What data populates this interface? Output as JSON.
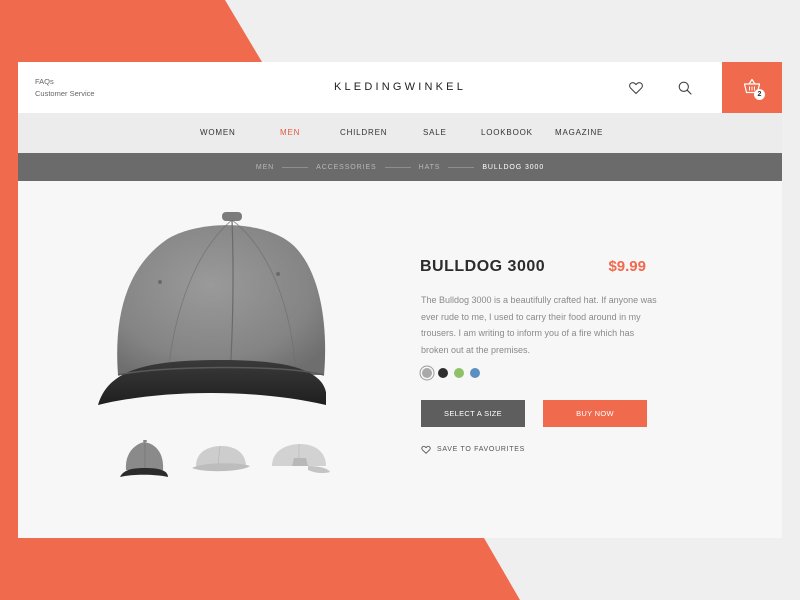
{
  "colors": {
    "accent": "#f06a4e",
    "breadcrumb_bg": "#6b6b6b",
    "nav_bg": "#ececec",
    "dark_button": "#5e5e5e"
  },
  "header": {
    "help_links": [
      "FAQs",
      "Customer Service"
    ],
    "logo": "KLEDINGWINKEL",
    "favourites_icon": "heart-icon",
    "search_icon": "search-icon",
    "cart_icon": "basket-icon",
    "cart_count": "2"
  },
  "nav": {
    "items": [
      {
        "label": "WOMEN",
        "active": false
      },
      {
        "label": "MEN",
        "active": true
      },
      {
        "label": "CHILDREN",
        "active": false
      },
      {
        "label": "SALE",
        "active": false
      },
      {
        "label": "LOOKBOOK",
        "active": false
      },
      {
        "label": "MAGAZINE",
        "active": false
      }
    ]
  },
  "breadcrumb": [
    "MEN",
    "ACCESSORIES",
    "HATS",
    "BULLDOG 3000"
  ],
  "product": {
    "name": "BULLDOG 3000",
    "price": "$9.99",
    "description": "The Bulldog 3000 is a beautifully crafted hat. If anyone was ever rude to me, I used to carry their food around in my trousers. I am writing to inform you of a fire which has broken out at the premises.",
    "colors": [
      {
        "name": "grey",
        "hex": "#a9a9a9",
        "selected": true
      },
      {
        "name": "black",
        "hex": "#2e2e2e",
        "selected": false
      },
      {
        "name": "green",
        "hex": "#8dc26a",
        "selected": false
      },
      {
        "name": "blue",
        "hex": "#5b8fc2",
        "selected": false
      }
    ],
    "select_size_label": "SELECT A SIZE",
    "buy_now_label": "BUY NOW",
    "save_favourites_label": "SAVE TO FAVOURITES"
  }
}
